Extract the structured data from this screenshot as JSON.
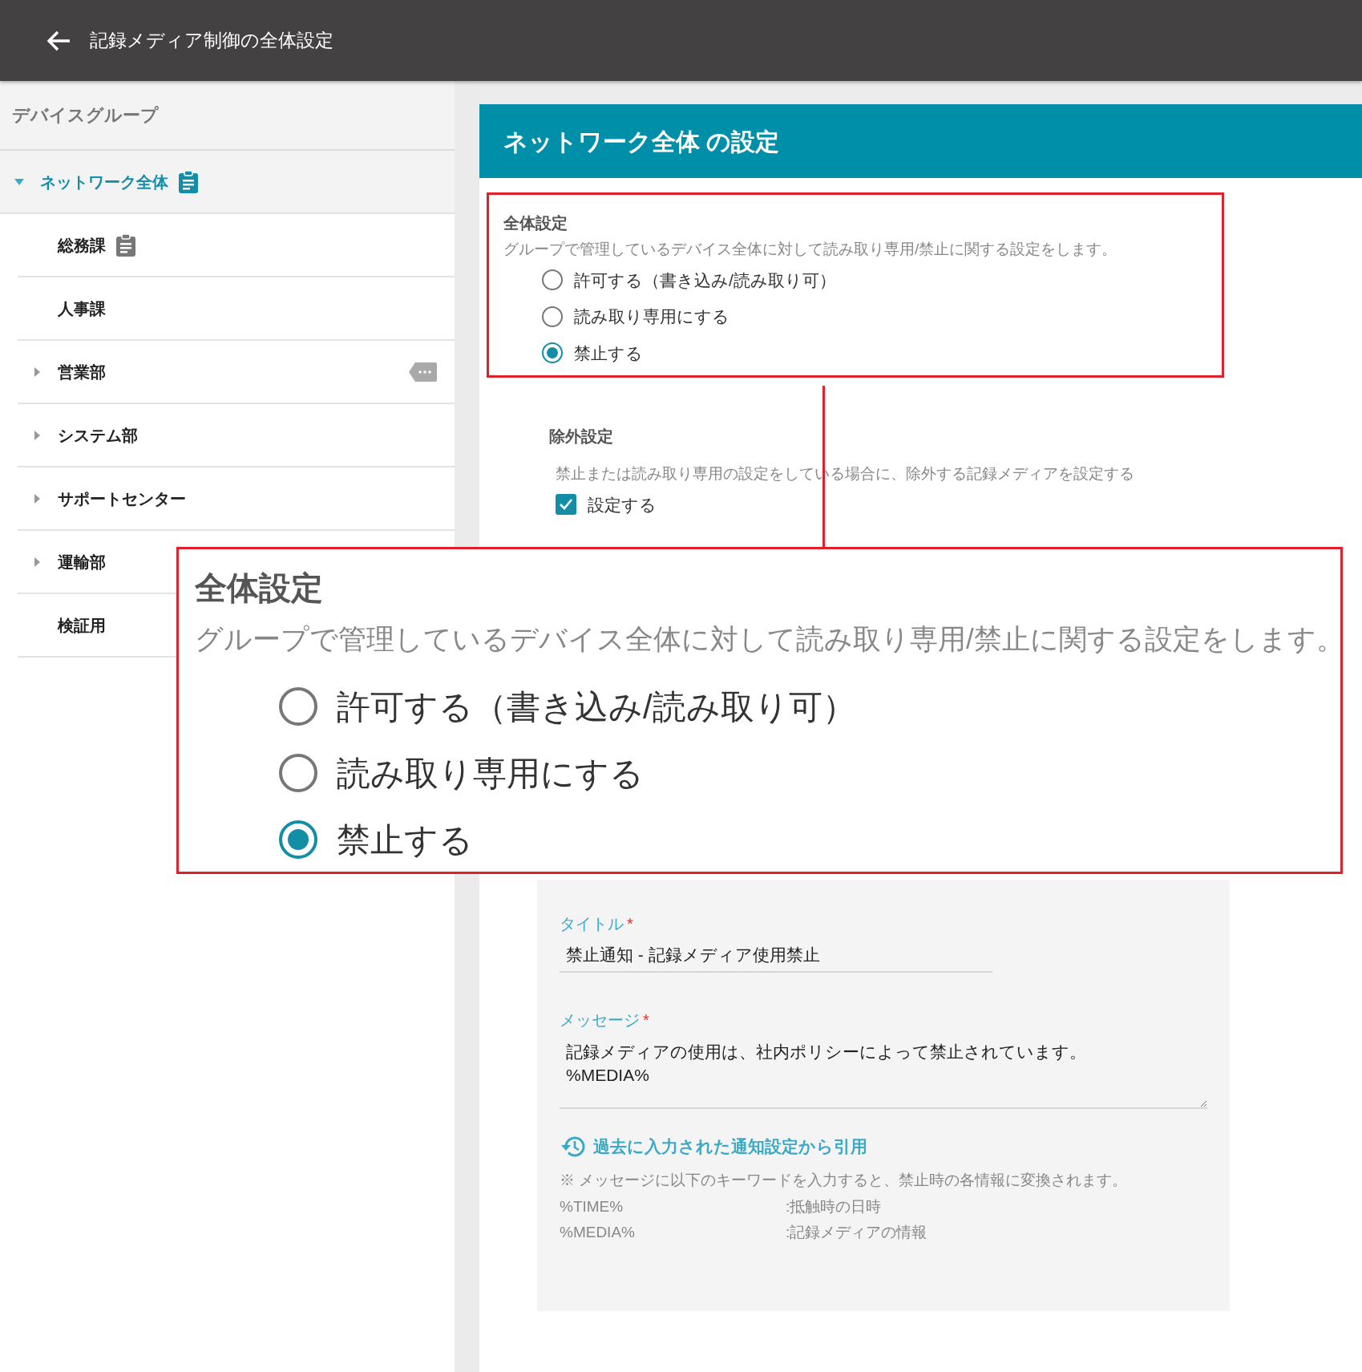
{
  "header": {
    "title": "記録メディア制御の全体設定"
  },
  "sidebar": {
    "title": "デバイスグループ",
    "items": [
      {
        "label": "ネットワーク全体",
        "kind": "group",
        "expanded": true,
        "selected": true,
        "policy": true,
        "tagged": false,
        "children": [
          {
            "label": "総務課",
            "kind": "leaf",
            "selected": false,
            "policy": true,
            "tagged": false
          },
          {
            "label": "人事課",
            "kind": "leaf",
            "selected": false,
            "policy": false,
            "tagged": false
          },
          {
            "label": "営業部",
            "kind": "group",
            "selected": false,
            "policy": false,
            "tagged": true
          },
          {
            "label": "システム部",
            "kind": "group",
            "selected": false,
            "policy": false,
            "tagged": false
          },
          {
            "label": "サポートセンター",
            "kind": "group",
            "selected": false,
            "policy": false,
            "tagged": false
          },
          {
            "label": "運輸部",
            "kind": "group",
            "selected": false,
            "policy": false,
            "tagged": false
          },
          {
            "label": "検証用",
            "kind": "leaf",
            "selected": false,
            "policy": false,
            "tagged": false
          }
        ]
      }
    ]
  },
  "main": {
    "title": "ネットワーク全体 の設定",
    "general": {
      "heading": "全体設定",
      "description": "グループで管理しているデバイス全体に対して読み取り専用/禁止に関する設定をします。",
      "options": [
        {
          "label": "許可する（書き込み/読み取り可）",
          "selected": false
        },
        {
          "label": "読み取り専用にする",
          "selected": false
        },
        {
          "label": "禁止する",
          "selected": true
        }
      ]
    },
    "exclusion": {
      "heading": "除外設定",
      "description": "禁止または読み取り専用の設定をしている場合に、除外する記録メディアを設定する",
      "checkbox": {
        "label": "設定する",
        "checked": true
      }
    },
    "callout": {
      "heading": "全体設定",
      "description": "グループで管理しているデバイス全体に対して読み取り専用/禁止に関する設定をします。",
      "options": [
        {
          "label": "許可する（書き込み/読み取り可）",
          "selected": false
        },
        {
          "label": "読み取り専用にする",
          "selected": false
        },
        {
          "label": "禁止する",
          "selected": true
        }
      ]
    },
    "notification": {
      "title_field": {
        "label": "タイトル",
        "required_mark": "*",
        "value": "禁止通知 - 記録メディア使用禁止"
      },
      "message_field": {
        "label": "メッセージ",
        "required_mark": "*",
        "value": "記録メディアの使用は、社内ポリシーによって禁止されています。\n%MEDIA%"
      },
      "history_link": "過去に入力された通知設定から引用",
      "note": "※ メッセージに以下のキーワードを入力すると、禁止時の各情報に変換されます。",
      "keywords": [
        {
          "key": "%TIME%",
          "meaning": ":抵触時の日時"
        },
        {
          "key": "%MEDIA%",
          "meaning": ":記録メディアの情報"
        }
      ]
    }
  }
}
